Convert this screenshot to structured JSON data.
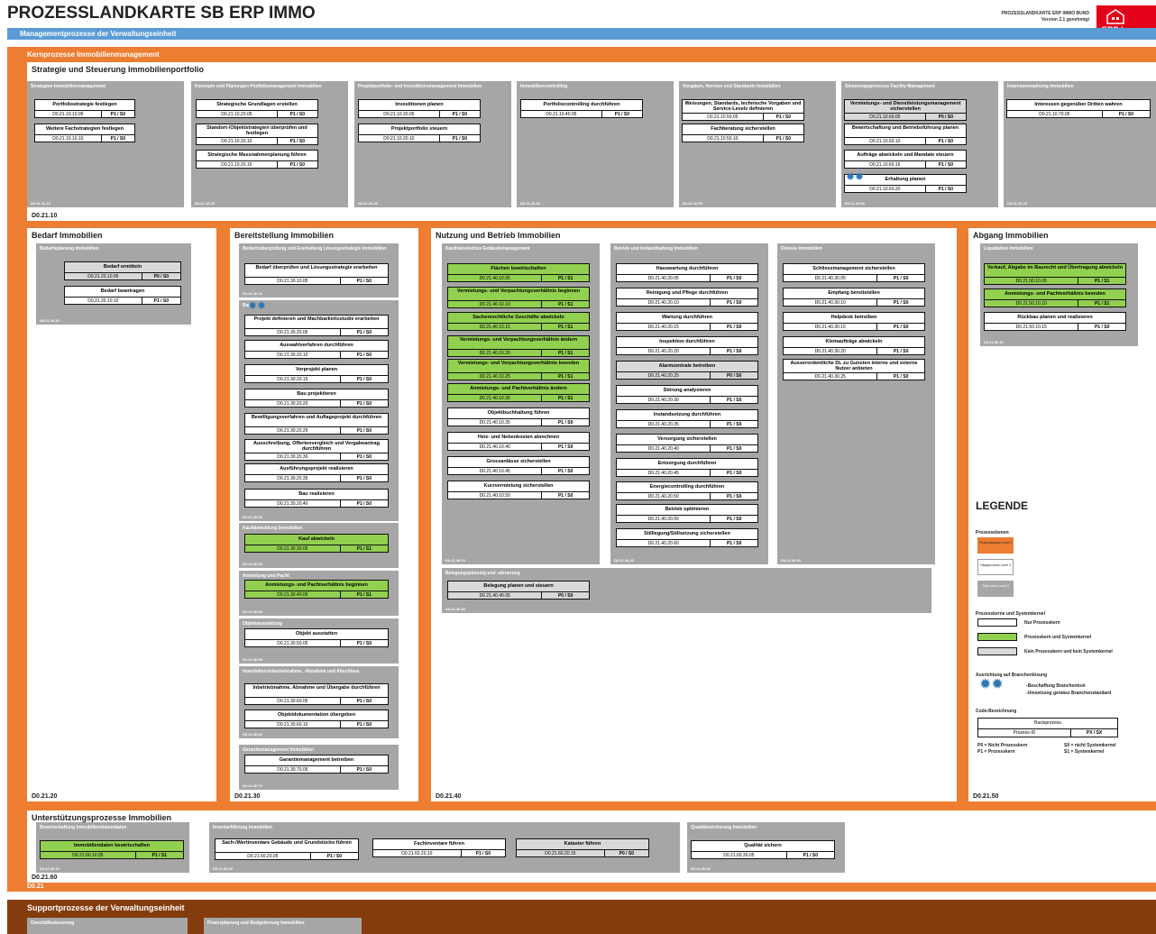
{
  "title": "PROZESSLANDKARTE SB ERP IMMO",
  "header_info": {
    "line1": "PROZESSLANDKARTE ERP IMMO BUND",
    "line2": "Version 2.1 genehmigt"
  },
  "logo": {
    "text": "ERP   Imm"
  },
  "mgmt_label": "Managementprozesse der Verwaltungseinheit",
  "kern_label": "Kernprozesse Immobilienmanagement",
  "strat": {
    "title": "Strategie und Steuerung Immobilienportfolio",
    "code": "D0.21.10"
  },
  "sections": [
    {
      "id": "bedarf",
      "title": "Bedarf Immobilien",
      "code": "D0.21.20"
    },
    {
      "id": "bereit",
      "title": "Bereitstellung Immobilien",
      "code": "D0.21.30"
    },
    {
      "id": "nutzung",
      "title": "Nutzung und Betrieb Immobilien",
      "code": "D0.21.40"
    },
    {
      "id": "abgang",
      "title": "Abgang Immobilien",
      "code": "D0.21.50"
    },
    {
      "id": "unter",
      "title": "Unterstützungsprozesse Immobilien",
      "code": "D0.21.60"
    }
  ],
  "kern_code": "D0.21",
  "support_label": "Supportprozesse der Verwaltungseinheit",
  "support_boxes": [
    "Geschäftssteuerung",
    "Finanzplanung und Budgetierung Immobilien"
  ],
  "hauptprozesse": [
    {
      "t": "Strategien Immobilienmanagement",
      "c": "D0.21.10.10"
    },
    {
      "t": "Konzepte und Planungen Portfoliomanagement Immobilien",
      "c": "D0.21.10.20"
    },
    {
      "t": "Projektportfolio- und Investitionsmanagement Immobilien",
      "c": "D0.21.10.30"
    },
    {
      "t": "Immobiliencontrolling",
      "c": "D0.21.10.40"
    },
    {
      "t": "Vorgaben, Normen und Standards Immobilien",
      "c": "D0.21.10.50"
    },
    {
      "t": "Steuerungsprozesse Facility Management",
      "c": "D0.21.10.60"
    },
    {
      "t": "Interessenwahrung Immobilien",
      "c": "D0.21.10.70"
    },
    {
      "t": "Bedarfsplanung Immobilien",
      "c": "D0.21.20.10"
    },
    {
      "t": "Bedarfsüberprüfung und Erarbeitung Lösungsstrategie Immobilien",
      "c": "D0.21.30.10"
    },
    {
      "t": "Bau",
      "c": "D0.21.30.20"
    },
    {
      "t": "Kaufabwicklung Immobilien",
      "c": "D0.21.30.30"
    },
    {
      "t": "Anmietung und Pacht",
      "c": "D0.21.30.40"
    },
    {
      "t": "Objektausstattung",
      "c": "D0.21.30.50"
    },
    {
      "t": "Immobilien-Inbetriebnahme, -Abnahme und Abschluss",
      "c": "D0.21.30.60"
    },
    {
      "t": "Garantiemanagement Immobilien",
      "c": "D0.21.30.70"
    },
    {
      "t": "Kaufmännisches Gebäudemanagement",
      "c": "D0.21.40.10"
    },
    {
      "t": "Betrieb und Instandhaltung Immobilien",
      "c": "D0.21.40.20"
    },
    {
      "t": "Dienste Immobilien",
      "c": "D0.21.40.30"
    },
    {
      "t": "Belegungsplanung und -steuerung",
      "c": "D0.21.40.40"
    },
    {
      "t": "Liquidation Immobilien",
      "c": "D0.21.50.10"
    },
    {
      "t": "Bewirtschaftung Immobilienstammdaten",
      "c": "D0.21.60.10"
    },
    {
      "t": "Inventarführung Immobilien",
      "c": "D0.21.60.20"
    },
    {
      "t": "Qualitätssicherung Immobilien",
      "c": "D0.21.60.30"
    }
  ],
  "processes": [
    {
      "n": "Portfoliostrategie festlegen",
      "id": "D0.21.10.10.05",
      "s": "P1 / S0",
      "t": "w"
    },
    {
      "n": "Weitere Fachstrategien festlegen",
      "id": "D0.21.10.10.10",
      "s": "P1 / S0",
      "t": "w"
    },
    {
      "n": "Strategische Grundlagen erstellen",
      "id": "D0.21.10.20.05",
      "s": "P1 / S0",
      "t": "w"
    },
    {
      "n": "Standort-/Objektstrategien überprüfen und festlegen",
      "id": "D0.21.10.20.10",
      "s": "P1 / S0",
      "t": "w"
    },
    {
      "n": "Strategische Massnahmenplanung führen",
      "id": "D0.21.10.20.15",
      "s": "P1 / S0",
      "t": "w"
    },
    {
      "n": "Investitionen planen",
      "id": "D0.21.10.30.05",
      "s": "P1 / S0",
      "t": "w"
    },
    {
      "n": "Projektportfolio steuern",
      "id": "D0.21.10.30.10",
      "s": "P1 / S0",
      "t": "w"
    },
    {
      "n": "Portfoliocontrolling durchführen",
      "id": "D0.21.10.40.05",
      "s": "P1 / S0",
      "t": "w"
    },
    {
      "n": "Weisungen, Standards, technische Vorgaben und Service-Levels definieren",
      "id": "D0.21.10.50.05",
      "s": "P1 / S0",
      "t": "w"
    },
    {
      "n": "Fachberatung sicherstellen",
      "id": "D0.21.10.50.10",
      "s": "P1 / S0",
      "t": "w"
    },
    {
      "n": "Vermietungs- und Dienstleistungsmanagement sicherstellen",
      "id": "D0.21.10.60.05",
      "s": "P0 / S0",
      "t": "gr"
    },
    {
      "n": "Bewirtschaftung und Betriebsführung planen",
      "id": "D0.21.10.60.10",
      "s": "P1 / S0",
      "t": "w"
    },
    {
      "n": "Aufträge abwickeln und Mandate steuern",
      "id": "D0.21.10.60.15",
      "s": "P1 / S0",
      "t": "w"
    },
    {
      "n": "Erhaltung planen",
      "id": "D0.21.10.60.20",
      "s": "P1 / S0",
      "t": "w"
    },
    {
      "n": "Interessen gegenüber Dritten wahren",
      "id": "D0.21.10.70.05",
      "s": "P1 / S0",
      "t": "w"
    },
    {
      "n": "Bedarf ermitteln",
      "id": "D0.21.20.10.05",
      "s": "P0 / S0",
      "t": "gr"
    },
    {
      "n": "Bedarf beantragen",
      "id": "D0.21.20.10.10",
      "s": "P1 / S0",
      "t": "w"
    },
    {
      "n": "Bedarf überprüfen und Lösungsstrategie erarbeiten",
      "id": "D0.21.30.10.05",
      "s": "P1 / S0",
      "t": "w"
    },
    {
      "n": "Projekt definieren und Machbarkeitsstudie erarbeiten",
      "id": "D0.21.30.20.05",
      "s": "P1 / S0",
      "t": "w"
    },
    {
      "n": "Auswahlverfahren durchführen",
      "id": "D0.21.30.20.10",
      "s": "P1 / S0",
      "t": "w"
    },
    {
      "n": "Vorprojekt planen",
      "id": "D0.21.30.20.15",
      "s": "P1 / S0",
      "t": "w"
    },
    {
      "n": "Bau projektieren",
      "id": "D0.21.30.20.20",
      "s": "P1 / S0",
      "t": "w"
    },
    {
      "n": "Bewilligungsverfahren und Auflageprojekt durchführen",
      "id": "D0.21.30.20.25",
      "s": "P1 / S0",
      "t": "w"
    },
    {
      "n": "Ausschreibung, Offertenvergleich und Vergabeantrag durchführen",
      "id": "D0.21.30.20.30",
      "s": "P1 / S0",
      "t": "w"
    },
    {
      "n": "Ausführungsprojekt realisieren",
      "id": "D0.21.30.20.35",
      "s": "P1 / S0",
      "t": "w"
    },
    {
      "n": "Bau realisieren",
      "id": "D0.21.30.20.40",
      "s": "P1 / S0",
      "t": "w"
    },
    {
      "n": "Kauf abwickeln",
      "id": "D0.21.30.30.05",
      "s": "P1 / S1",
      "t": "g"
    },
    {
      "n": "Anmietungs- und Pachtverhältnis beginnen",
      "id": "D0.21.30.40.05",
      "s": "P1 / S1",
      "t": "g"
    },
    {
      "n": "Objekt ausstatten",
      "id": "D0.21.30.50.05",
      "s": "P1 / S0",
      "t": "w"
    },
    {
      "n": "Inbetriebnahme, Abnahme und Übergabe durchführen",
      "id": "D0.21.30.60.05",
      "s": "P1 / S0",
      "t": "w"
    },
    {
      "n": "Objektdokumentation übergeben",
      "id": "D0.21.30.60.10",
      "s": "P1 / S0",
      "t": "w"
    },
    {
      "n": "Garantiemanagement betreiben",
      "id": "D0.21.30.70.05",
      "s": "P1 / S0",
      "t": "w"
    },
    {
      "n": "Flächen bewirtschaften",
      "id": "D0.21.40.10.05",
      "s": "P1 / S1",
      "t": "g"
    },
    {
      "n": "Vermietungs- und Verpachtungsverhältnis beginnen",
      "id": "D0.21.40.10.10",
      "s": "P1 / S1",
      "t": "g"
    },
    {
      "n": "Sachenrechtliche Geschäfte abwickeln",
      "id": "D0.21.40.10.15",
      "s": "P1 / S1",
      "t": "g"
    },
    {
      "n": "Vermietungs- und Verpachtungsverhältnis ändern",
      "id": "D0.21.40.10.20",
      "s": "P1 / S1",
      "t": "g"
    },
    {
      "n": "Vermietungs- und Verpachtungsverhältnis beenden",
      "id": "D0.21.40.10.25",
      "s": "P1 / S1",
      "t": "g"
    },
    {
      "n": "Anmietungs- und Pachtverhältnis ändern",
      "id": "D0.21.40.10.30",
      "s": "P1 / S1",
      "t": "g"
    },
    {
      "n": "Objektbuchhaltung führen",
      "id": "D0.21.40.10.35",
      "s": "P1 / S0",
      "t": "w"
    },
    {
      "n": "Heiz- und Nebenkosten abrechnen",
      "id": "D0.21.40.10.40",
      "s": "P1 / S0",
      "t": "w"
    },
    {
      "n": "Grossanlässe sicherstellen",
      "id": "D0.21.40.10.45",
      "s": "P1 / S0",
      "t": "w"
    },
    {
      "n": "Kurzvermietung sicherstellen",
      "id": "D0.21.40.10.50",
      "s": "P1 / S0",
      "t": "w"
    },
    {
      "n": "Hauswartung durchführen",
      "id": "D0.21.40.20.05",
      "s": "P1 / S0",
      "t": "w"
    },
    {
      "n": "Reinigung und Pflege durchführen",
      "id": "D0.21.40.20.10",
      "s": "P1 / S0",
      "t": "w"
    },
    {
      "n": "Wartung durchführen",
      "id": "D0.21.40.20.15",
      "s": "P1 / S0",
      "t": "w"
    },
    {
      "n": "Inspektion durchführen",
      "id": "D0.21.40.20.20",
      "s": "P1 / S0",
      "t": "w"
    },
    {
      "n": "Alarmzentrale betreiben",
      "id": "D0.21.40.20.25",
      "s": "P0 / S0",
      "t": "gr"
    },
    {
      "n": "Störung analysieren",
      "id": "D0.21.40.20.30",
      "s": "P1 / S0",
      "t": "w"
    },
    {
      "n": "Instandsetzung durchführen",
      "id": "D0.21.40.20.35",
      "s": "P1 / S0",
      "t": "w"
    },
    {
      "n": "Versorgung sicherstellen",
      "id": "D0.21.40.20.40",
      "s": "P1 / S0",
      "t": "w"
    },
    {
      "n": "Entsorgung durchführen",
      "id": "D0.21.40.20.45",
      "s": "P1 / S0",
      "t": "w"
    },
    {
      "n": "Energiecontrolling durchführen",
      "id": "D0.21.40.20.50",
      "s": "P1 / S0",
      "t": "w"
    },
    {
      "n": "Betrieb optimieren",
      "id": "D0.21.40.20.55",
      "s": "P1 / S0",
      "t": "w"
    },
    {
      "n": "Stilllegung/Stillsetzung sicherstellen",
      "id": "D0.21.40.20.60",
      "s": "P1 / S0",
      "t": "w"
    },
    {
      "n": "Schliessmanagement sicherstellen",
      "id": "D0.21.40.30.05",
      "s": "P1 / S0",
      "t": "w"
    },
    {
      "n": "Empfang bereitstellen",
      "id": "D0.21.40.30.10",
      "s": "P1 / S0",
      "t": "w"
    },
    {
      "n": "Helpdesk betreiben",
      "id": "D0.21.40.30.15",
      "s": "P1 / S0",
      "t": "w"
    },
    {
      "n": "Kleinaufträge abwickeln",
      "id": "D0.21.40.30.20",
      "s": "P1 / S0",
      "t": "w"
    },
    {
      "n": "Ausserordentliche DL zu Gunsten interne und externe Nutzer anbieten",
      "id": "D0.21.40.30.25",
      "s": "P1 / S0",
      "t": "w"
    },
    {
      "n": "Belegung planen und steuern",
      "id": "D0.21.40.40.05",
      "s": "P0 / S0",
      "t": "gr"
    },
    {
      "n": "Verkauf, Abgabe im Baurecht und Übertragung abwickeln",
      "id": "D0.21.50.10.05",
      "s": "P1 / S1",
      "t": "g"
    },
    {
      "n": "Anmietungs- und Pachtverhältnis beenden",
      "id": "D0.21.50.10.10",
      "s": "P1 / S1",
      "t": "g"
    },
    {
      "n": "Rückbau planen und realisieren",
      "id": "D0.21.50.10.15",
      "s": "P1 / S0",
      "t": "w"
    },
    {
      "n": "Immobiliendaten bewirtschaften",
      "id": "D0.21.60.10.05",
      "s": "P1 / S1",
      "t": "g"
    },
    {
      "n": "Sach-/Wertinventare Gebäude und Grundstücke führen",
      "id": "D0.21.60.20.05",
      "s": "P1 / S0",
      "t": "w"
    },
    {
      "n": "Fachinventare führen",
      "id": "D0.21.60.20.10",
      "s": "P1 / S0",
      "t": "w"
    },
    {
      "n": "Kataster führen",
      "id": "D0.21.60.20.15",
      "s": "P0 / S0",
      "t": "gr"
    },
    {
      "n": "Qualität sichern",
      "id": "D0.21.60.30.05",
      "s": "P1 / S0",
      "t": "w"
    }
  ],
  "legend": {
    "title": "LEGENDE",
    "ebenen_title": "Prozessebenen",
    "ebenen": [
      "Prozessgruppe Level 1",
      "Hauptprozess Level 2",
      "Teilprozess Level 3"
    ],
    "kerne_title": "Prozesskerne und Systemkernel",
    "kerne": [
      "Nur Prozesskern",
      "Prozesskern und Systemkernel",
      "Kein Prozesskern und kein Systemkernel"
    ],
    "branche_title": "Ausrichtung auf Branchenlösung",
    "branche": [
      "-Beschaffung Branchentool",
      "-Umsetzung gemäss Branchenstandard"
    ],
    "code_title": "Code-Bezeichnung",
    "code_box": {
      "name": "Basisprozess",
      "id": "Prozess-ID",
      "s": "PX / SX"
    },
    "notes": [
      "P0 = Nicht Prozesskern",
      "S0 = nicht Systemkernel",
      "P1 = Prozesskern",
      "S1 = Systemkernel"
    ]
  }
}
